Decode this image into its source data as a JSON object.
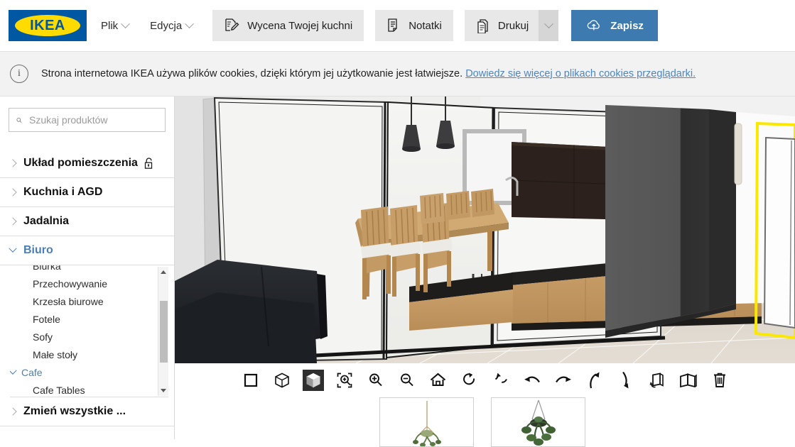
{
  "app": {
    "brand": "IKEA",
    "brand_registered": "®",
    "colors": {
      "ikea_blue": "#0058a3",
      "ikea_yellow": "#ffdb00",
      "save_button_blue": "#3d7ab0",
      "link_blue": "#4a86c5",
      "expanded_category_blue": "#4a7fb5",
      "toolbar_button_grey": "#e8e8e8"
    }
  },
  "topbar": {
    "menus": [
      {
        "label": "Plik",
        "icon": "chevron-down-icon"
      },
      {
        "label": "Edycja",
        "icon": "chevron-down-icon"
      }
    ],
    "buttons": [
      {
        "label": "Wycena Twojej kuchni",
        "icon": "quote-pencil-icon"
      },
      {
        "label": "Notatki",
        "icon": "notes-icon"
      },
      {
        "label": "Drukuj",
        "icon": "print-icon",
        "has_split_arrow": true
      },
      {
        "label": "Zapisz",
        "icon": "cloud-upload-icon",
        "primary": true
      }
    ]
  },
  "cookiebar": {
    "icon": "info-icon",
    "message": "Strona internetowa IKEA używa plików cookies, dzięki którym jej użytkowanie jest łatwiejsze.",
    "link": "Dowiedz się więcej o plikach cookies przeglądarki."
  },
  "sidebar": {
    "search": {
      "icon": "search-icon",
      "placeholder": "Szukaj produktów",
      "value": ""
    },
    "categories": [
      {
        "label": "Układ pomieszczenia",
        "expanded": false,
        "badge_icon": "unlocked-padlock-icon"
      },
      {
        "label": "Kuchnia i AGD",
        "expanded": false
      },
      {
        "label": "Jadalnia",
        "expanded": false
      },
      {
        "label": "Biuro",
        "expanded": true
      }
    ],
    "subitems": [
      {
        "label": "Biurka",
        "type": "child",
        "clipped": true
      },
      {
        "label": "Przechowywanie",
        "type": "child"
      },
      {
        "label": "Krzesła biurowe",
        "type": "child"
      },
      {
        "label": "Fotele",
        "type": "child"
      },
      {
        "label": "Sofy",
        "type": "child"
      },
      {
        "label": "Małe stoły",
        "type": "child"
      },
      {
        "label": "Cafe",
        "type": "group",
        "expanded": true
      },
      {
        "label": "Cafe Tables",
        "type": "child"
      }
    ],
    "footer_category": {
      "label": "Zmień wszystkie ...",
      "expanded": false
    }
  },
  "viewport": {
    "mode": "3d",
    "scene_description": "Kitchen and dining room 3D render with sliding glass doors, pendant lamps, wooden dining table with six chairs, dark sofa, kitchen counter with wood base cabinets and dark upper cabinets, tiled floor and a highlighted door outlined in yellow"
  },
  "view_toolbar": {
    "buttons": [
      {
        "name": "2d-view-button",
        "icon": "square-icon",
        "active": false
      },
      {
        "name": "3d-wireframe-view-button",
        "icon": "cube-outline-icon",
        "active": false
      },
      {
        "name": "3d-solid-view-button",
        "icon": "cube-filled-icon",
        "active": true
      },
      {
        "name": "zoom-to-fit-button",
        "icon": "zoom-fit-icon",
        "active": false
      },
      {
        "name": "zoom-in-button",
        "icon": "magnifier-plus-icon",
        "active": false
      },
      {
        "name": "zoom-out-button",
        "icon": "magnifier-minus-icon",
        "active": false
      },
      {
        "name": "home-view-button",
        "icon": "home-icon",
        "active": false
      },
      {
        "name": "rotate-cw-button",
        "icon": "rotate-clockwise-icon",
        "active": false
      },
      {
        "name": "rotate-ccw-button",
        "icon": "rotate-counterclockwise-icon",
        "active": false
      },
      {
        "name": "pan-left-button",
        "icon": "curved-arrow-left-icon",
        "active": false
      },
      {
        "name": "pan-right-button",
        "icon": "curved-arrow-right-icon",
        "active": false
      },
      {
        "name": "tilt-up-button",
        "icon": "curved-arrow-up-icon",
        "active": false
      },
      {
        "name": "tilt-down-button",
        "icon": "curved-arrow-down-icon",
        "active": false
      },
      {
        "name": "rotate-object-button",
        "icon": "box-rotate-icon",
        "active": false
      },
      {
        "name": "open-walls-button",
        "icon": "folded-walls-icon",
        "active": false
      },
      {
        "name": "delete-button",
        "icon": "trash-icon",
        "active": false
      }
    ]
  },
  "product_strip": {
    "items": [
      {
        "name": "hanging-plant-1",
        "icon": "hanging-plant-icon"
      },
      {
        "name": "hanging-plant-2",
        "icon": "hanging-plant-icon"
      }
    ]
  }
}
